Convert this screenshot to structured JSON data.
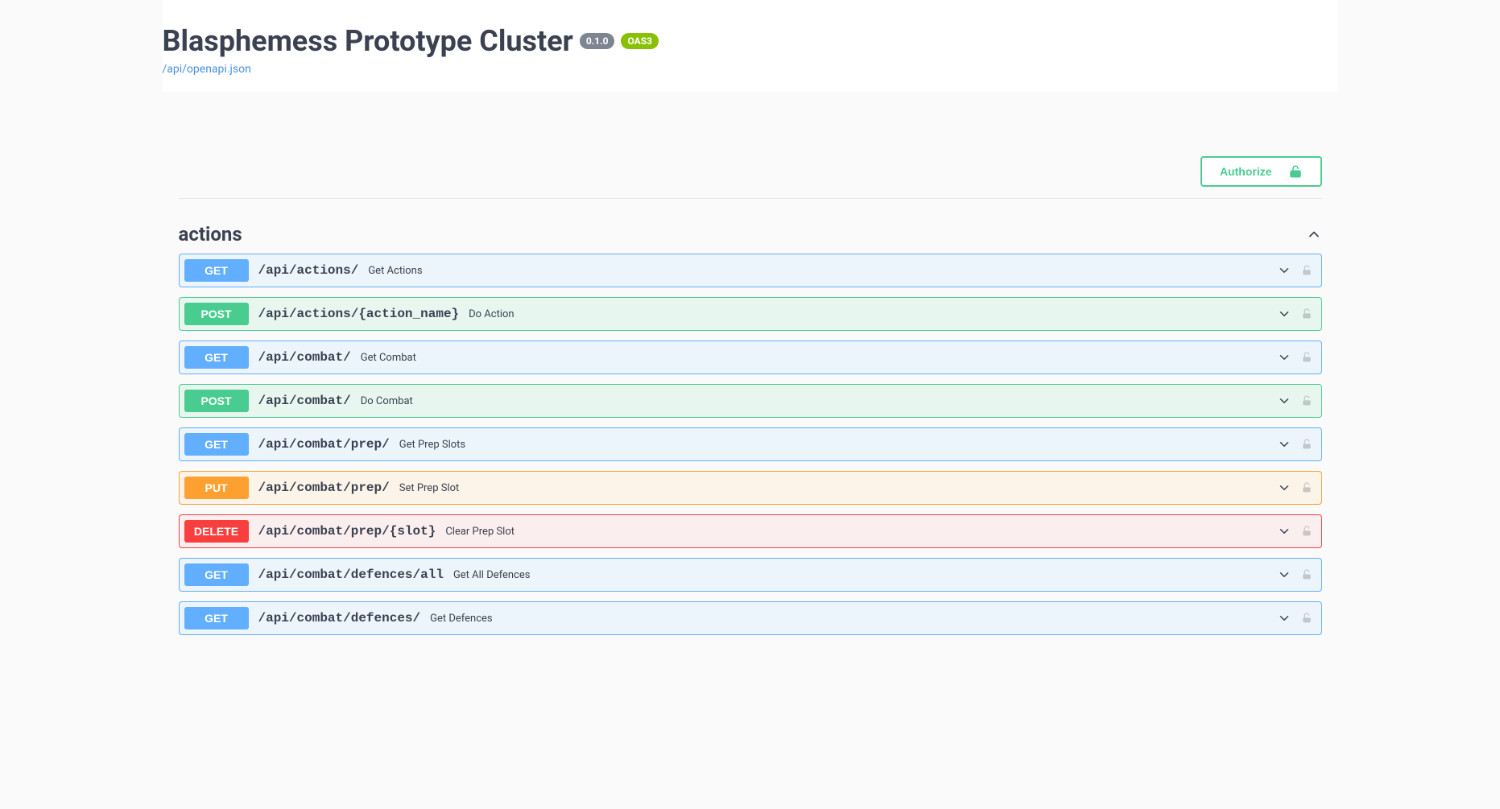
{
  "header": {
    "title": "Blasphemess Prototype Cluster",
    "version": "0.1.0",
    "oas": "OAS3",
    "spec_link": "/api/openapi.json"
  },
  "auth": {
    "button_label": "Authorize"
  },
  "section": {
    "name": "actions"
  },
  "operations": [
    {
      "method": "GET",
      "path": "/api/actions/",
      "summary": "Get Actions"
    },
    {
      "method": "POST",
      "path": "/api/actions/{action_name}",
      "summary": "Do Action"
    },
    {
      "method": "GET",
      "path": "/api/combat/",
      "summary": "Get Combat"
    },
    {
      "method": "POST",
      "path": "/api/combat/",
      "summary": "Do Combat"
    },
    {
      "method": "GET",
      "path": "/api/combat/prep/",
      "summary": "Get Prep Slots"
    },
    {
      "method": "PUT",
      "path": "/api/combat/prep/",
      "summary": "Set Prep Slot"
    },
    {
      "method": "DELETE",
      "path": "/api/combat/prep/{slot}",
      "summary": "Clear Prep Slot"
    },
    {
      "method": "GET",
      "path": "/api/combat/defences/all",
      "summary": "Get All Defences"
    },
    {
      "method": "GET",
      "path": "/api/combat/defences/",
      "summary": "Get Defences"
    }
  ]
}
